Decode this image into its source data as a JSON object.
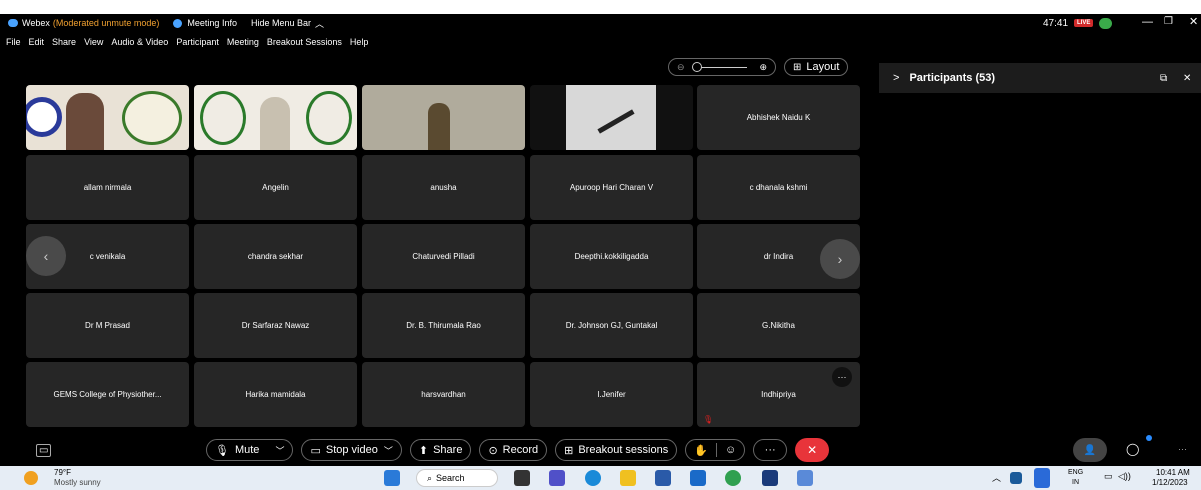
{
  "title_bar": {
    "app_name": "Webex",
    "mode": "(Moderated unmute mode)",
    "meeting_info": "Meeting Info",
    "hide_menu": "Hide Menu Bar",
    "timer": "47:41",
    "live": "LIVE"
  },
  "menu": [
    "File",
    "Edit",
    "Share",
    "View",
    "Audio & Video",
    "Participant",
    "Meeting",
    "Breakout Sessions",
    "Help"
  ],
  "layout_label": "Layout",
  "participants_panel": {
    "title": "Participants (53)"
  },
  "tiles": [
    {
      "name": ""
    },
    {
      "name": ""
    },
    {
      "name": ""
    },
    {
      "name": ""
    },
    {
      "name": "Abhishek Naidu K"
    },
    {
      "name": "allam nirmala"
    },
    {
      "name": "Angelin"
    },
    {
      "name": "anusha"
    },
    {
      "name": "Apuroop Hari Charan V"
    },
    {
      "name": "c dhanala kshmi"
    },
    {
      "name": "c venikala"
    },
    {
      "name": "chandra sekhar"
    },
    {
      "name": "Chaturvedi Pilladi"
    },
    {
      "name": "Deepthi.kokkiligadda"
    },
    {
      "name": "dr Indira"
    },
    {
      "name": "Dr M Prasad"
    },
    {
      "name": "Dr Sarfaraz Nawaz"
    },
    {
      "name": "Dr. B. Thirumala Rao"
    },
    {
      "name": "Dr. Johnson GJ, Guntakal"
    },
    {
      "name": "G.Nikitha"
    },
    {
      "name": "GEMS College of Physiother..."
    },
    {
      "name": "Harika mamidala"
    },
    {
      "name": "harsvardhan"
    },
    {
      "name": "I.Jenifer"
    },
    {
      "name": "Indhipriya"
    }
  ],
  "controls": {
    "mute": "Mute",
    "stop_video": "Stop video",
    "share": "Share",
    "record": "Record",
    "breakout": "Breakout sessions"
  },
  "taskbar": {
    "weather_temp": "79°F",
    "weather_desc": "Mostly sunny",
    "search": "Search",
    "lang1": "ENG",
    "lang2": "IN",
    "time": "10:41 AM",
    "date": "1/12/2023"
  },
  "colors": {
    "accent_red": "#e02020",
    "live_red": "#d12b2b",
    "mode_orange": "#f0a030",
    "end_call": "#e8343a"
  }
}
